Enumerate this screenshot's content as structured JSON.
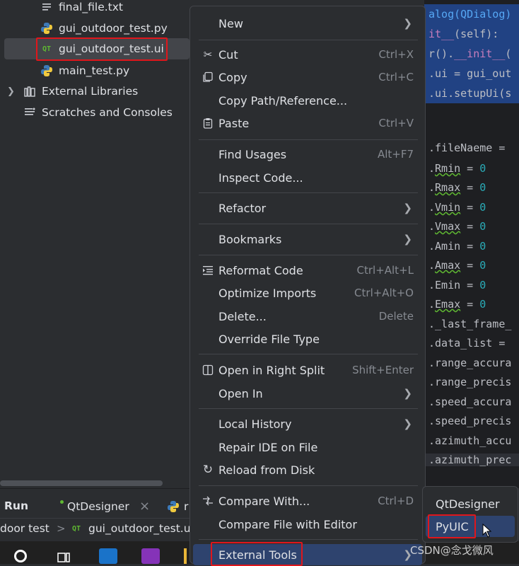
{
  "project_tree": {
    "items": [
      {
        "label": "final_file.txt",
        "icon": "text-file-icon"
      },
      {
        "label": "gui_outdoor_test.py",
        "icon": "python-icon"
      },
      {
        "label": "gui_outdoor_test.ui",
        "icon": "qt-ui-file-icon",
        "icon_text": "QT"
      },
      {
        "label": "main_test.py",
        "icon": "python-icon"
      },
      {
        "label": "External Libraries",
        "icon": "library-icon"
      },
      {
        "label": "Scratches and Consoles",
        "icon": "scratches-icon"
      }
    ]
  },
  "editor": {
    "lines": [
      {
        "pre": "",
        "a": "alog(QDialog)",
        "b": "",
        "c": ""
      },
      {
        "pre": "",
        "a": "it__",
        "b": "(self):",
        "c": ""
      },
      {
        "pre": "",
        "a": "r().",
        "b": "__init__",
        "c": "("
      },
      {
        "pre": "",
        "a": ".ui = gui_out",
        "b": "",
        "c": ""
      },
      {
        "pre": "",
        "a": ".ui.setupUi(s",
        "b": "",
        "c": ""
      },
      {
        "pre": "",
        "a": ".fileNaeme = ",
        "b": "",
        "c": ""
      },
      {
        "pre": ".",
        "a": "Rmin",
        "b": " = ",
        "c": "0"
      },
      {
        "pre": ".",
        "a": "Rmax",
        "b": " = ",
        "c": "0"
      },
      {
        "pre": ".",
        "a": "Vmin",
        "b": " = ",
        "c": "0"
      },
      {
        "pre": ".",
        "a": "Vmax",
        "b": " = ",
        "c": "0"
      },
      {
        "pre": ".",
        "a": "Amin",
        "b": " = ",
        "c": "0"
      },
      {
        "pre": ".",
        "a": "Amax",
        "b": " = ",
        "c": "0"
      },
      {
        "pre": ".",
        "a": "Emin",
        "b": " = ",
        "c": "0"
      },
      {
        "pre": ".",
        "a": "Emax",
        "b": " = ",
        "c": "0"
      },
      {
        "pre": "",
        "a": "._last_frame_",
        "b": "",
        "c": ""
      },
      {
        "pre": "",
        "a": ".data_list = ",
        "b": "",
        "c": ""
      },
      {
        "pre": "",
        "a": ".range_accura",
        "b": "",
        "c": ""
      },
      {
        "pre": "",
        "a": ".range_precis",
        "b": "",
        "c": ""
      },
      {
        "pre": "",
        "a": ".speed_accura",
        "b": "",
        "c": ""
      },
      {
        "pre": "",
        "a": ".speed_precis",
        "b": "",
        "c": ""
      },
      {
        "pre": "",
        "a": ".azimuth_accu",
        "b": "",
        "c": ""
      },
      {
        "pre": "",
        "a": ".azimuth_prec",
        "b": "",
        "c": ""
      }
    ]
  },
  "run_panel": {
    "title": "Run",
    "tab_qtdesigner": "QtDesigner",
    "tab_close": "×",
    "tab_partial": "r",
    "breadcrumb_project": "door test",
    "breadcrumb_sep": ">",
    "breadcrumb_icon_text": "QT",
    "breadcrumb_file": "gui_outdoor_test.ui"
  },
  "context_menu": {
    "items": [
      {
        "label": "New",
        "shortcut": "",
        "submenu": true,
        "icon": ""
      },
      {
        "label": "Cut",
        "shortcut": "Ctrl+X",
        "submenu": false,
        "icon": "scissors-icon"
      },
      {
        "label": "Copy",
        "shortcut": "Ctrl+C",
        "submenu": false,
        "icon": "copy-icon"
      },
      {
        "label": "Copy Path/Reference...",
        "shortcut": "",
        "submenu": false,
        "icon": ""
      },
      {
        "label": "Paste",
        "shortcut": "Ctrl+V",
        "submenu": false,
        "icon": "paste-icon"
      },
      {
        "label": "Find Usages",
        "shortcut": "Alt+F7",
        "submenu": false,
        "icon": ""
      },
      {
        "label": "Inspect Code...",
        "shortcut": "",
        "submenu": false,
        "icon": ""
      },
      {
        "label": "Refactor",
        "shortcut": "",
        "submenu": true,
        "icon": ""
      },
      {
        "label": "Bookmarks",
        "shortcut": "",
        "submenu": true,
        "icon": ""
      },
      {
        "label": "Reformat Code",
        "shortcut": "Ctrl+Alt+L",
        "submenu": false,
        "icon": "reformat-icon"
      },
      {
        "label": "Optimize Imports",
        "shortcut": "Ctrl+Alt+O",
        "submenu": false,
        "icon": ""
      },
      {
        "label": "Delete...",
        "shortcut": "Delete",
        "submenu": false,
        "icon": ""
      },
      {
        "label": "Override File Type",
        "shortcut": "",
        "submenu": false,
        "icon": ""
      },
      {
        "label": "Open in Right Split",
        "shortcut": "Shift+Enter",
        "submenu": false,
        "icon": "split-icon"
      },
      {
        "label": "Open In",
        "shortcut": "",
        "submenu": true,
        "icon": ""
      },
      {
        "label": "Local History",
        "shortcut": "",
        "submenu": true,
        "icon": ""
      },
      {
        "label": "Repair IDE on File",
        "shortcut": "",
        "submenu": false,
        "icon": ""
      },
      {
        "label": "Reload from Disk",
        "shortcut": "",
        "submenu": false,
        "icon": "reload-icon"
      },
      {
        "label": "Compare With...",
        "shortcut": "Ctrl+D",
        "submenu": false,
        "icon": "compare-icon"
      },
      {
        "label": "Compare File with Editor",
        "shortcut": "",
        "submenu": false,
        "icon": ""
      },
      {
        "label": "External Tools",
        "shortcut": "",
        "submenu": true,
        "icon": ""
      }
    ]
  },
  "submenu": {
    "items": [
      {
        "label": "QtDesigner"
      },
      {
        "label": "PyUIC"
      }
    ]
  },
  "watermark": "CSDN@念戈微风",
  "colors": {
    "menu_bg": "#2b2d30",
    "highlight": "#2e436e",
    "selection": "#214283",
    "annotation_red": "#e0161b"
  }
}
